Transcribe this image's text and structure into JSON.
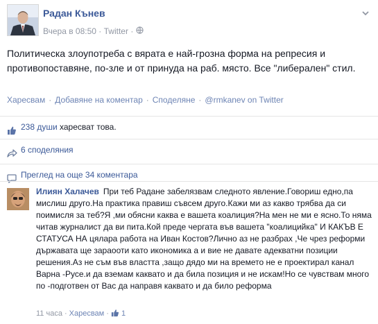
{
  "post": {
    "author": "Радан Кънев",
    "timestamp": "Вчера в 08:50",
    "source": "Twitter",
    "text": "Политическа злоупотреба с вярата е най-грозна форма на репресия и противопоставяне, по-зле и от принуда на раб. място. Все \"либерален\" стил.",
    "actions": {
      "like": "Харесвам",
      "comment": "Добавяне на коментар",
      "share": "Споделяне",
      "via": "@rmkanev on Twitter"
    },
    "likes_count": "238 души",
    "likes_suffix": " харесват това.",
    "shares": "6 споделяния",
    "more_comments": "Преглед на още 34 коментара",
    "separator": "·"
  },
  "comment": {
    "author": "Илиян Халачев",
    "text": "При теб Радане забелязвам следното явление.Говориш едно,па мислиш друго.На практика правиш съвсем друго.Кажи ми аз какво трябва да си поимисля за теб?Я ,ми обясни каква е вашета коалиция?На мен не ми е ясно.То няма читав журналист да ви пита.Кой преде чергата във вашета \"коалицийка\" И КАКЪВ Е СТАТУСА НА цялара работа на Иван Костов?Лично аз не разбрах ,Че чрез реформи държавата ще зараооти като икономика а и вие не давате адекватни позиции решения.Аз не съм във властта ,защо дядо ми на времето не е проектирал канал Варна -Русе.и да вземам каквато и да била позиция и не искам!Но се чувствам много по -подготвен от Вас да направя каквато и да било реформа",
    "time": "11 часа",
    "like": "Харесвам",
    "likes": "1"
  },
  "colors": {
    "link": "#3b5998",
    "muted": "#9197a3",
    "border": "#e5e5e5"
  },
  "icons": [
    "globe-icon",
    "chevron-down-icon",
    "thumbs-up-icon",
    "share-arrow-icon",
    "speech-bubble-icon"
  ]
}
